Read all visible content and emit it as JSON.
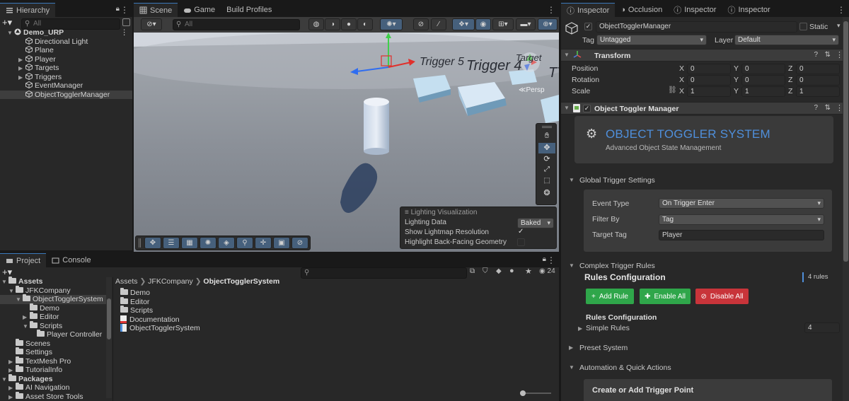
{
  "hierarchy": {
    "tab": "Hierarchy",
    "search_placeholder": "All",
    "items": [
      {
        "label": "Demo_URP",
        "depth": 0,
        "arrow": "▼",
        "kind": "scene"
      },
      {
        "label": "Directional Light",
        "depth": 1,
        "arrow": "",
        "kind": "obj"
      },
      {
        "label": "Plane",
        "depth": 1,
        "arrow": "",
        "kind": "obj"
      },
      {
        "label": "Player",
        "depth": 1,
        "arrow": "▶",
        "kind": "obj"
      },
      {
        "label": "Targets",
        "depth": 1,
        "arrow": "▶",
        "kind": "obj"
      },
      {
        "label": "Triggers",
        "depth": 1,
        "arrow": "▶",
        "kind": "obj"
      },
      {
        "label": "EventManager",
        "depth": 1,
        "arrow": "",
        "kind": "obj"
      },
      {
        "label": "ObjectTogglerManager",
        "depth": 1,
        "arrow": "",
        "kind": "obj",
        "selected": true
      }
    ]
  },
  "scene": {
    "tabs": [
      "Scene",
      "Game",
      "Build Profiles"
    ],
    "search_placeholder": "All",
    "labels": [
      "Trigger 5",
      "Trigger 4",
      "Target",
      "TT"
    ],
    "persp": "Persp",
    "lighting": {
      "title": "Lighting Visualization",
      "rows": [
        {
          "label": "Lighting Data",
          "value": "Baked"
        },
        {
          "label": "Show Lightmap Resolution",
          "value": "✓"
        },
        {
          "label": "Highlight Back-Facing Geometry",
          "value": ""
        }
      ]
    }
  },
  "project": {
    "tabs": [
      "Project",
      "Console"
    ],
    "count": "24",
    "breadcrumb": [
      "Assets",
      "JFKCompany",
      "ObjectTogglerSystem"
    ],
    "tree": [
      {
        "label": "Assets",
        "depth": 0,
        "arrow": "▼",
        "bold": true
      },
      {
        "label": "JFKCompany",
        "depth": 1,
        "arrow": "▼"
      },
      {
        "label": "ObjectTogglerSystem",
        "depth": 2,
        "arrow": "▼",
        "selected": true
      },
      {
        "label": "Demo",
        "depth": 3,
        "arrow": ""
      },
      {
        "label": "Editor",
        "depth": 3,
        "arrow": "▶"
      },
      {
        "label": "Scripts",
        "depth": 3,
        "arrow": "▼"
      },
      {
        "label": "Player Controller",
        "depth": 4,
        "arrow": ""
      },
      {
        "label": "Scenes",
        "depth": 1,
        "arrow": ""
      },
      {
        "label": "Settings",
        "depth": 1,
        "arrow": ""
      },
      {
        "label": "TextMesh Pro",
        "depth": 1,
        "arrow": "▶"
      },
      {
        "label": "TutorialInfo",
        "depth": 1,
        "arrow": "▶"
      },
      {
        "label": "Packages",
        "depth": 0,
        "arrow": "▼",
        "bold": true
      },
      {
        "label": "AI Navigation",
        "depth": 1,
        "arrow": "▶"
      },
      {
        "label": "Asset Store Tools",
        "depth": 1,
        "arrow": "▶"
      }
    ],
    "files": [
      {
        "label": "Demo",
        "kind": "folder"
      },
      {
        "label": "Editor",
        "kind": "folder"
      },
      {
        "label": "Scripts",
        "kind": "folder"
      },
      {
        "label": "Documentation",
        "kind": "pdf"
      },
      {
        "label": "ObjectTogglerSystem",
        "kind": "asset"
      }
    ]
  },
  "inspector": {
    "tabs": [
      "Inspector",
      "Occlusion",
      "Inspector",
      "Inspector"
    ],
    "object_name": "ObjectTogglerManager",
    "static_label": "Static",
    "tag_label": "Tag",
    "tag_value": "Untagged",
    "layer_label": "Layer",
    "layer_value": "Default",
    "transform": {
      "title": "Transform",
      "rows": [
        {
          "label": "Position",
          "x": "0",
          "y": "0",
          "z": "0"
        },
        {
          "label": "Rotation",
          "x": "0",
          "y": "0",
          "z": "0"
        },
        {
          "label": "Scale",
          "x": "1",
          "y": "1",
          "z": "1"
        }
      ]
    },
    "component_title": "Object Toggler Manager",
    "banner_title": "OBJECT TOGGLER SYSTEM",
    "banner_subtitle": "Advanced Object State Management",
    "global": {
      "title": "Global Trigger Settings",
      "event_type_label": "Event Type",
      "event_type_value": "On Trigger Enter",
      "filter_by_label": "Filter By",
      "filter_by_value": "Tag",
      "target_tag_label": "Target Tag",
      "target_tag_value": "Player"
    },
    "complex": {
      "title": "Complex Trigger Rules",
      "rules_config": "Rules Configuration",
      "rules_count": "4 rules",
      "add_rule": "Add Rule",
      "enable_all": "Enable All",
      "disable_all": "Disable All",
      "rules_config2": "Rules Configuration",
      "simple_rules_label": "Simple Rules",
      "simple_rules_value": "4"
    },
    "preset_title": "Preset System",
    "automation_title": "Automation & Quick Actions",
    "create_trigger": "Create or Add Trigger Point"
  },
  "colors": {
    "accent": "#4f8fdb",
    "green": "#2fa64a",
    "red": "#c8343a"
  }
}
